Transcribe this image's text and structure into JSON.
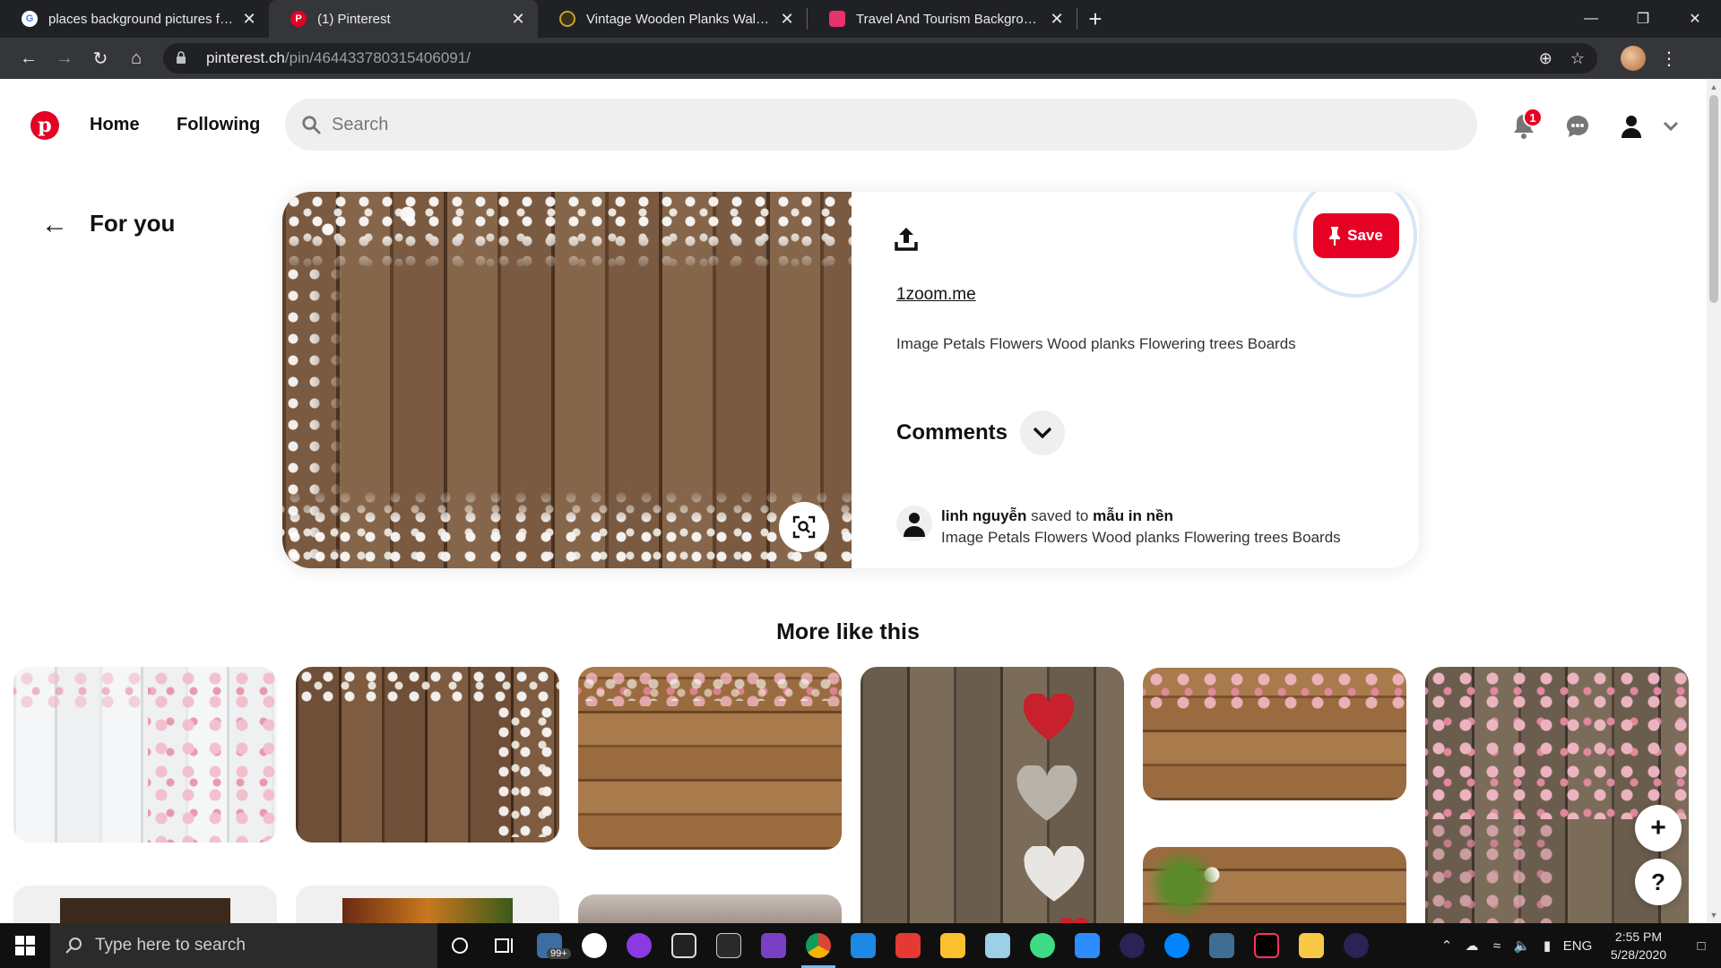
{
  "browser": {
    "tabs": [
      {
        "title": "places background pictures for a",
        "favicon_color": "#ffffff",
        "favicon_letter": "G",
        "active": false
      },
      {
        "title": "(1) Pinterest",
        "favicon_color": "#e60023",
        "favicon_letter": "P",
        "active": true
      },
      {
        "title": "Vintage Wooden Planks Wall Bac",
        "favicon_color": "#b8860b",
        "favicon_letter": "",
        "active": false
      },
      {
        "title": "Travel And Tourism Background V",
        "favicon_color": "#e8336d",
        "favicon_letter": "",
        "active": false
      }
    ],
    "new_tab_label": "+",
    "url_host": "pinterest.ch",
    "url_path": "/pin/464433780315406091/"
  },
  "pinterest": {
    "nav": {
      "home": "Home",
      "following": "Following"
    },
    "search_placeholder": "Search",
    "notification_count": "1",
    "back_label": "For you",
    "pin": {
      "save_label": "Save",
      "source": "1zoom.me",
      "description": "Image Petals Flowers Wood planks Flowering trees Boards",
      "comments_label": "Comments",
      "saver_name": "linh nguyễn",
      "saver_action": "saved to",
      "saver_board": "mẫu in nền",
      "saver_caption": "Image Petals Flowers Wood planks Flowering trees Boards"
    },
    "more_title": "More like this",
    "float_add": "+",
    "float_help": "?"
  },
  "taskbar": {
    "search_placeholder": "Type here to search",
    "badge": "99+",
    "language": "ENG",
    "time": "2:55 PM",
    "date": "5/28/2020"
  },
  "colors": {
    "brand_red": "#e60023",
    "save_ring": "#d7e6f6"
  }
}
